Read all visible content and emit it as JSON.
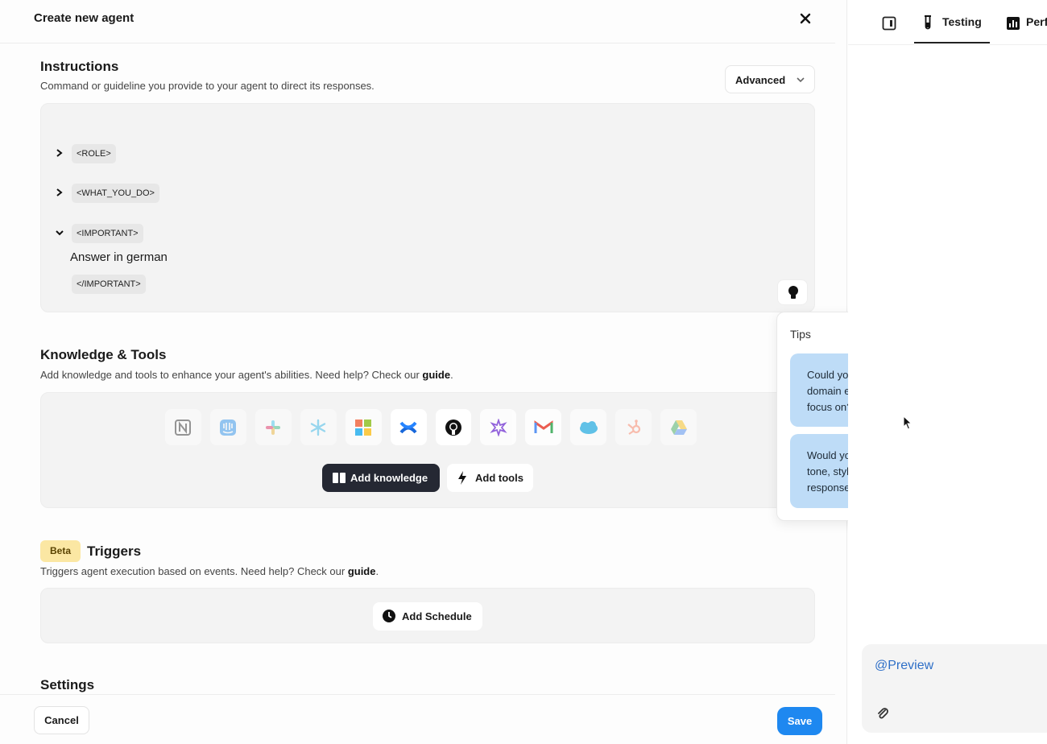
{
  "header": {
    "title": "Create new agent"
  },
  "instructions": {
    "title": "Instructions",
    "subtitle": "Command or guideline you provide to your agent to direct its responses.",
    "mode_label": "Advanced",
    "tags": {
      "role": "<ROLE>",
      "what_you_do": "<WHAT_YOU_DO>",
      "important": "<IMPORTANT>",
      "important_close": "</IMPORTANT>"
    },
    "important_text": "Answer in german"
  },
  "knowledge": {
    "title": "Knowledge & Tools",
    "subtitle_prefix": "Add knowledge and tools to enhance your agent's abilities. Need help? Check our ",
    "guide_link": "guide",
    "subtitle_suffix": ".",
    "integrations": [
      "notion-icon",
      "intercom-icon",
      "slack-icon",
      "snowflake-icon",
      "microsoft-icon",
      "confluence-icon",
      "github-icon",
      "zapier-icon",
      "gmail-icon",
      "salesforce-icon",
      "hubspot-icon",
      "google-drive-icon"
    ],
    "add_knowledge_label": "Add knowledge",
    "add_tools_label": "Add tools"
  },
  "triggers": {
    "badge": "Beta",
    "title": "Triggers",
    "subtitle_prefix": "Triggers agent execution based on events. Need help? Check our ",
    "guide_link": "guide",
    "subtitle_suffix": ".",
    "add_schedule_label": "Add Schedule"
  },
  "settings": {
    "title": "Settings"
  },
  "footer": {
    "cancel_label": "Cancel",
    "save_label": "Save"
  },
  "tips": {
    "title": "Tips",
    "items": [
      "Could you specify what specific tasks or domain expertise this assistant should focus on?",
      "Would you like to define the assistant's tone, style, or level of formality for responses?"
    ]
  },
  "right_panel": {
    "tabs": {
      "testing": "Testing",
      "performance": "Perf"
    },
    "preview_mention": "@Preview"
  },
  "colors": {
    "accent": "#1e88f0",
    "tip_bg": "#bedcf7",
    "beta_bg": "#fbe7a3",
    "dark_button": "#252833"
  }
}
